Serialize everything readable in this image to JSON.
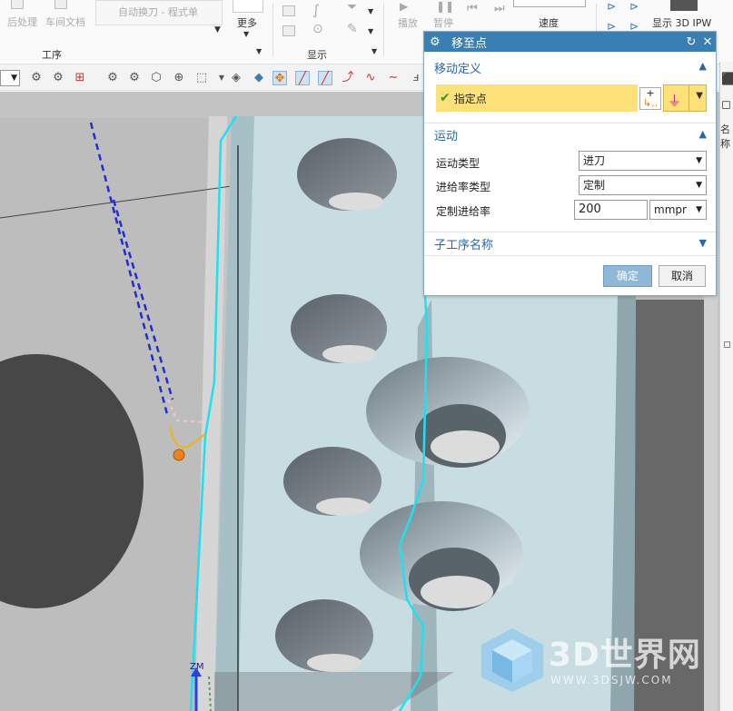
{
  "ribbon": {
    "post_process": "后处理",
    "shop_doc": "车间文档",
    "auto_tool_change": "自动换刀 - 程式单",
    "more": "更多",
    "group_operation": "工序",
    "group_display": "显示",
    "play": "播放",
    "pause": "暂停",
    "speed": "速度",
    "show_3d_ipw": "显示 3D IPW"
  },
  "dialog": {
    "title": "移至点",
    "sections": {
      "move_definition": "移动定义",
      "motion": "运动",
      "sub_operation_name": "子工序名称"
    },
    "specify_point": "指定点",
    "fields": {
      "motion_type_label": "运动类型",
      "motion_type_value": "进刀",
      "feed_rate_type_label": "进给率类型",
      "feed_rate_type_value": "定制",
      "custom_feed_rate_label": "定制进给率",
      "custom_feed_rate_value": "200",
      "feed_unit_value": "mmpr"
    },
    "ok": "确定",
    "cancel": "取消"
  },
  "axis_label": "ZM",
  "right_panel_label": "名称",
  "watermark": {
    "brand": "3D世界网",
    "url": "WWW.3DSJW.COM"
  },
  "colors": {
    "title_bar": "#3a7fb4",
    "section_text": "#2a66a8",
    "highlight_yellow": "#ffe17a",
    "tool_path_cyan": "#1fe0f0",
    "approach_blue": "#1f2fd0",
    "part_face": "#c8dde2"
  }
}
